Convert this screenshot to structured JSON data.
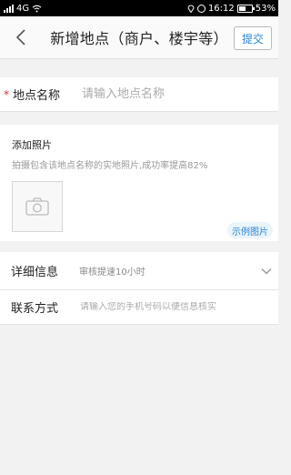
{
  "status_bar": {
    "network": "4G",
    "time": "16:12",
    "battery_pct": "53%",
    "battery_level": 0.53
  },
  "header": {
    "title": "新增地点（商户、楼宇等）",
    "submit_label": "提交"
  },
  "name_field": {
    "required_mark": "*",
    "label": "地点名称",
    "placeholder": "请输入地点名称"
  },
  "photo": {
    "title": "添加照片",
    "hint": "拍摄包含该地点名称的实地照片,成功率提高82%",
    "example_label": "示例图片"
  },
  "details": {
    "label": "详细信息",
    "value": "审核提速10小时"
  },
  "contact": {
    "label": "联系方式",
    "placeholder": "请输入您的手机号码以便信息核实"
  },
  "icons": {
    "back": "chevron-left-icon",
    "camera": "camera-icon",
    "expand": "chevron-down-icon"
  },
  "colors": {
    "accent": "#2a83d6",
    "required": "#e03030",
    "background": "#f2f2f2"
  }
}
